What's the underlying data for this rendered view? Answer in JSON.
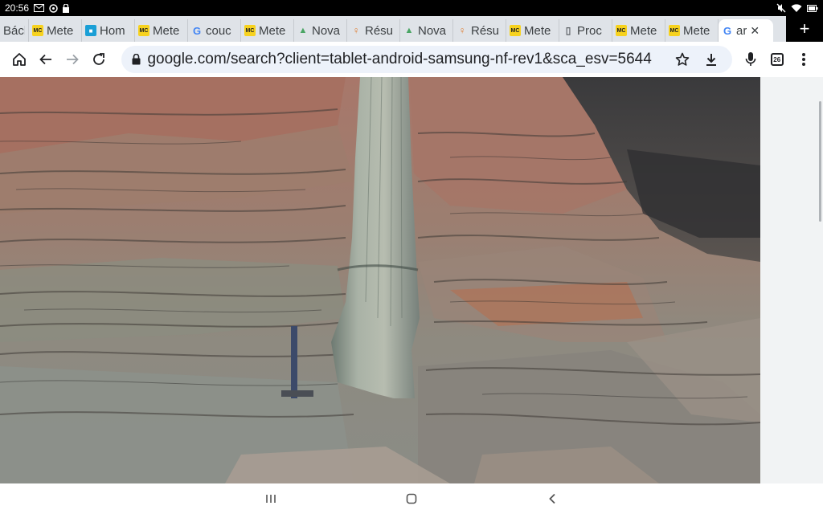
{
  "status": {
    "time": "20:56",
    "left_icons": [
      "mail-icon",
      "sync-icon",
      "lock-icon"
    ],
    "right_icons": [
      "mute-icon",
      "wifi-icon",
      "battery-icon"
    ]
  },
  "tabs": [
    {
      "label": "Bách",
      "favicon": "doc"
    },
    {
      "label": "Mete",
      "favicon": "mc"
    },
    {
      "label": "Hom",
      "favicon": "home"
    },
    {
      "label": "Mete",
      "favicon": "mc"
    },
    {
      "label": "couc",
      "favicon": "g"
    },
    {
      "label": "Mete",
      "favicon": "mc"
    },
    {
      "label": "Nova",
      "favicon": "nova"
    },
    {
      "label": "Résu",
      "favicon": "res"
    },
    {
      "label": "Nova",
      "favicon": "nova"
    },
    {
      "label": "Résu",
      "favicon": "res"
    },
    {
      "label": "Mete",
      "favicon": "mc"
    },
    {
      "label": "Proc",
      "favicon": "doc"
    },
    {
      "label": "Mete",
      "favicon": "mc"
    },
    {
      "label": "Mete",
      "favicon": "mc"
    },
    {
      "label": "ar",
      "favicon": "g",
      "active": true
    }
  ],
  "toolbar": {
    "url_domain": "google.com",
    "url_path": "/search?client=tablet-android-samsung-nf-rev1&sca_esv=5644",
    "tab_count": "26"
  },
  "colors": {
    "status_bg": "#000000",
    "tab_strip_bg": "#dfe3e8",
    "omnibox_bg": "#edf2fa",
    "rock_rust": "#a8745e",
    "rock_gray": "#8f948f"
  }
}
